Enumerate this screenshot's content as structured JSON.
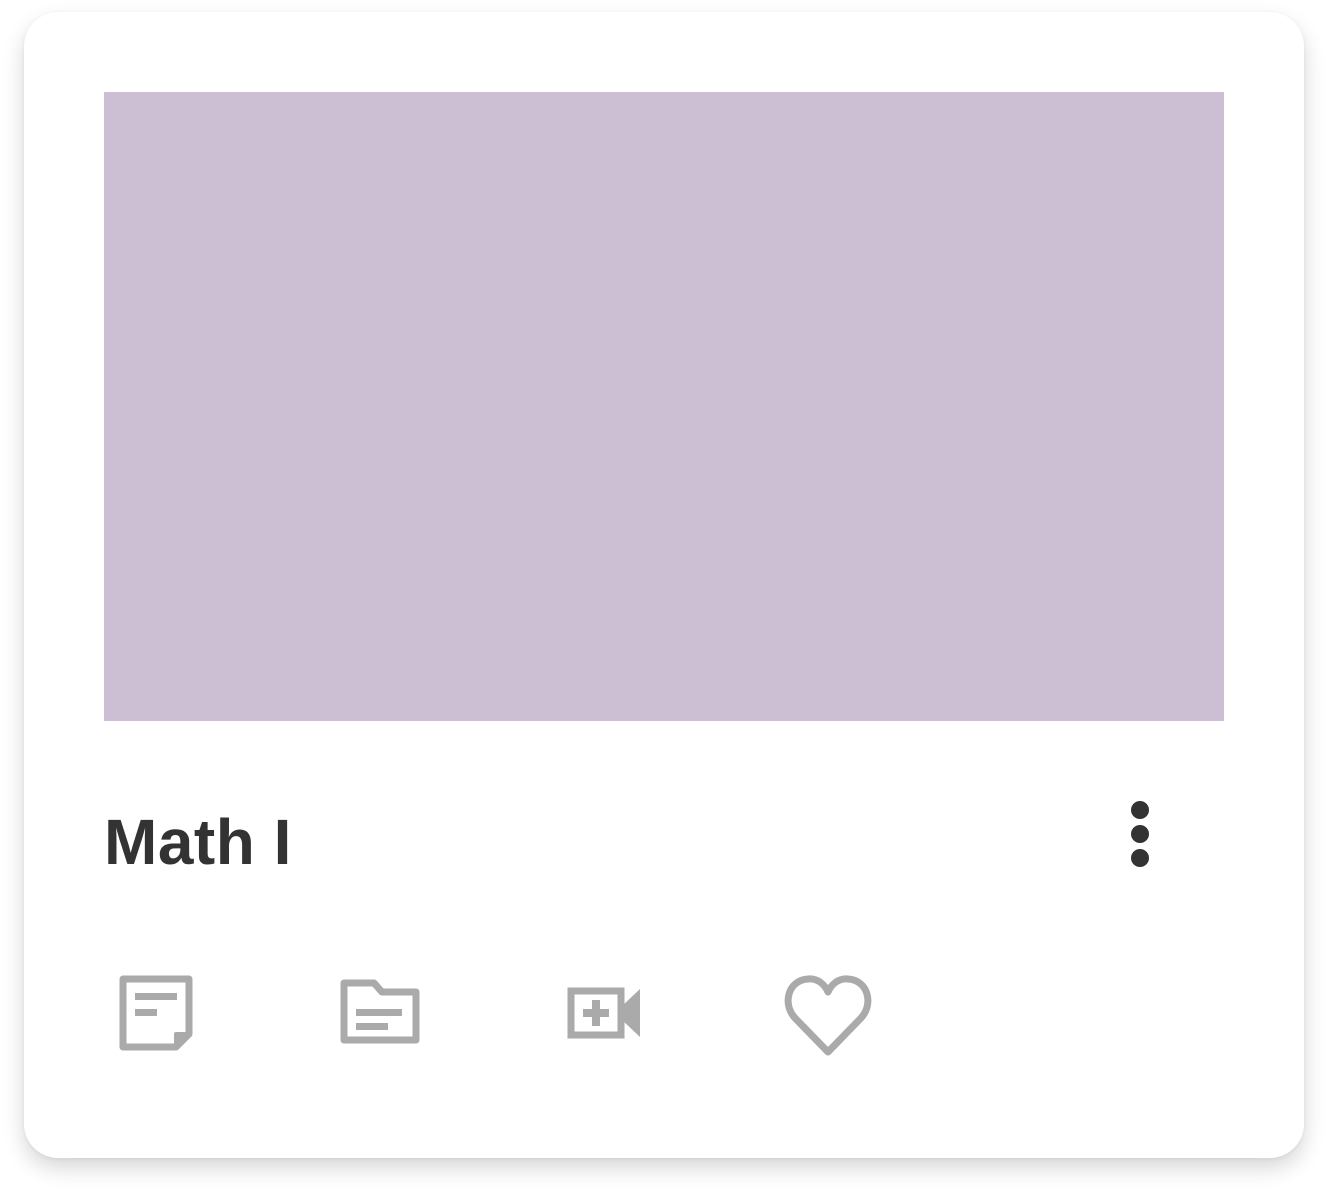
{
  "card": {
    "title": "Math I",
    "cover_color": "#CCBFD4",
    "icon_color": "#AAAAAA",
    "text_color": "#333333"
  },
  "menu": {
    "icon": "more-vertical-icon"
  },
  "actions": [
    {
      "id": "notes",
      "icon": "note-icon"
    },
    {
      "id": "folder",
      "icon": "folder-icon"
    },
    {
      "id": "video-call",
      "icon": "video-add-icon"
    },
    {
      "id": "favorite",
      "icon": "heart-outline-icon"
    }
  ]
}
